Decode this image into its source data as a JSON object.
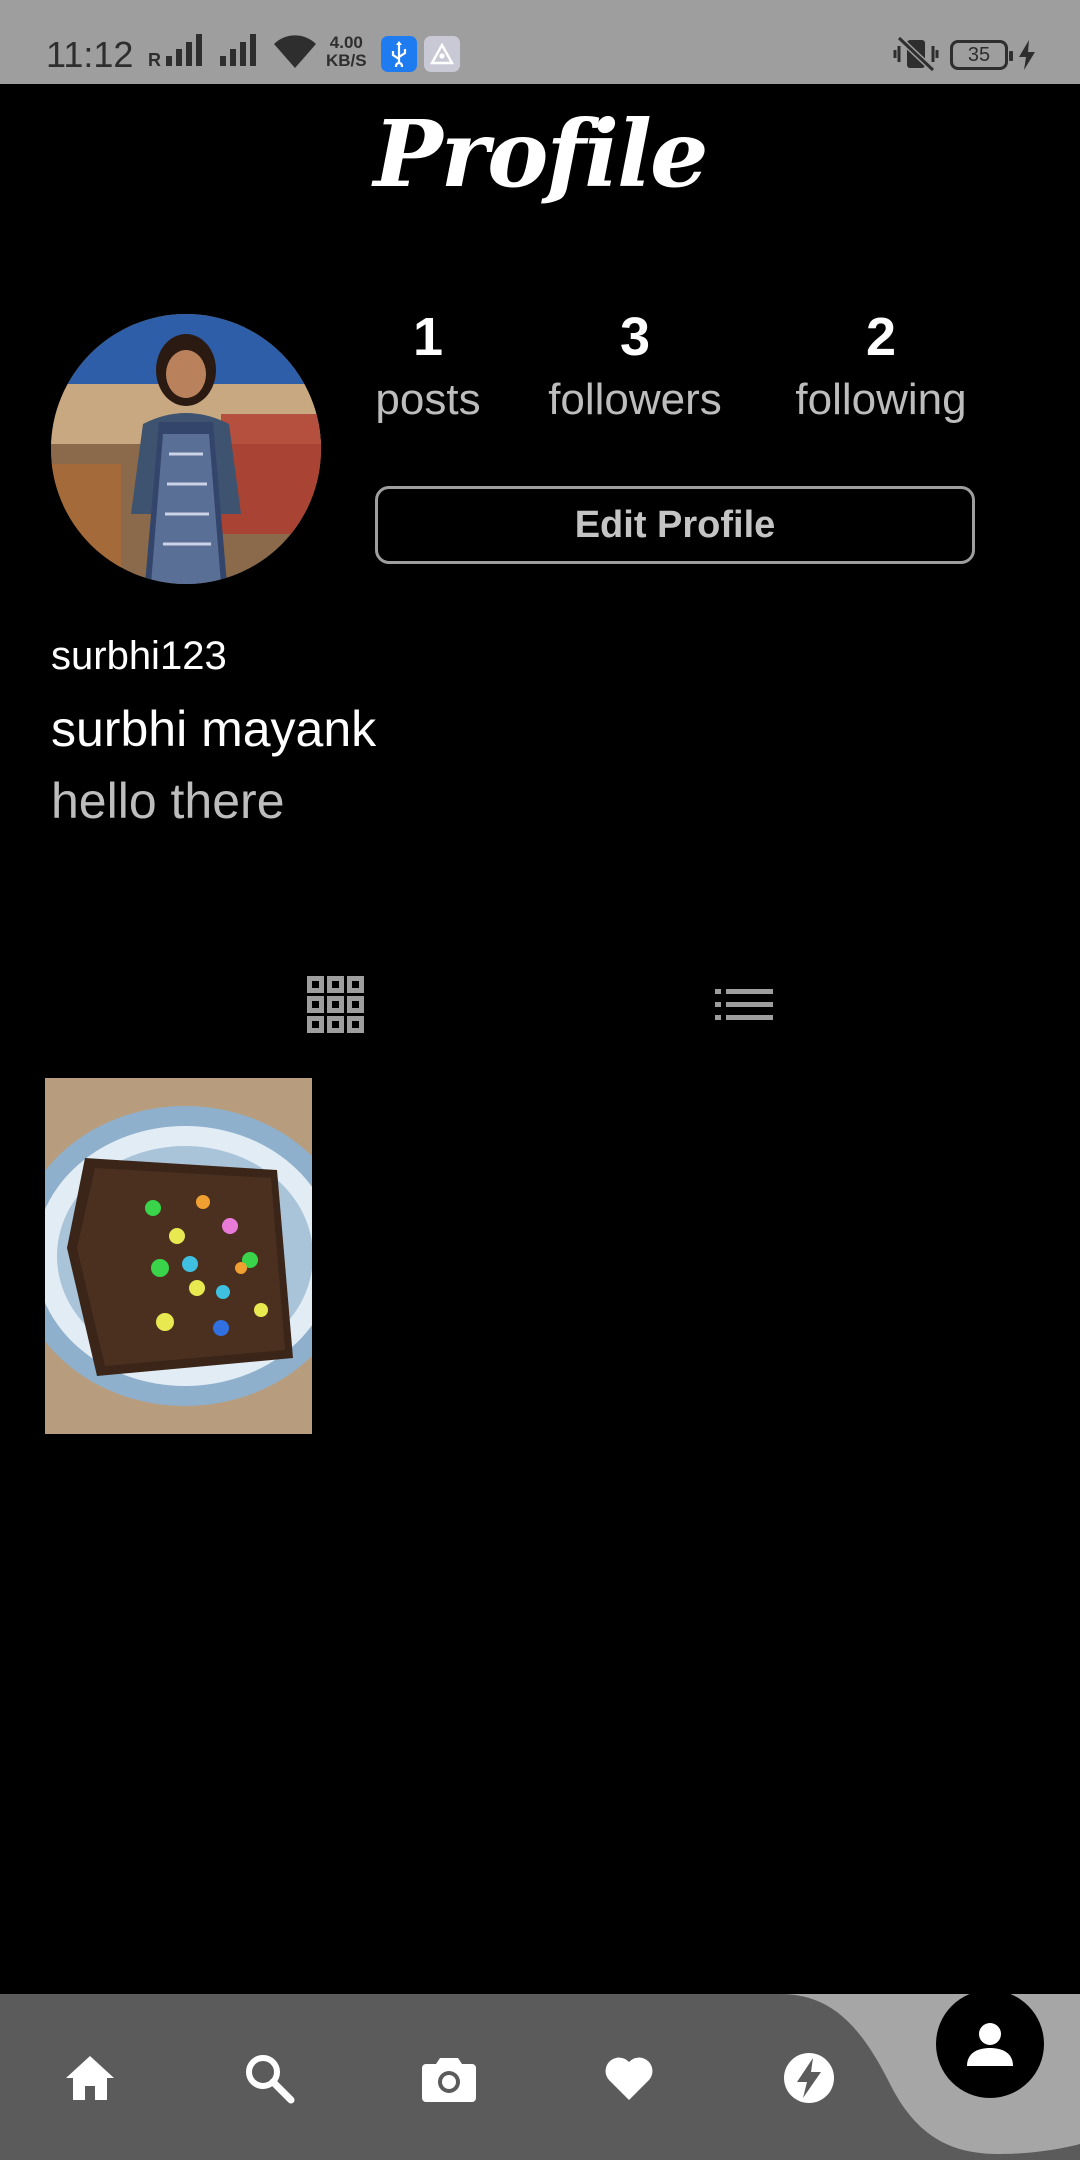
{
  "status_bar": {
    "time": "11:12",
    "network_label": "R",
    "speed_value": "4.00",
    "speed_unit": "KB/S",
    "battery": "35"
  },
  "header": {
    "title": "Profile"
  },
  "profile": {
    "stats": [
      {
        "value": "1",
        "label": "posts"
      },
      {
        "value": "3",
        "label": "followers"
      },
      {
        "value": "2",
        "label": "following"
      }
    ],
    "edit_button": "Edit Profile",
    "username": "surbhi123",
    "full_name": "surbhi mayank",
    "bio": "hello there"
  },
  "tabs": [
    {
      "icon": "grid-icon",
      "active": true
    },
    {
      "icon": "list-icon",
      "active": false
    }
  ],
  "posts_count": 1,
  "bottom_nav": {
    "items": [
      "home-icon",
      "search-icon",
      "camera-icon",
      "heart-icon",
      "flash-icon",
      "person-icon"
    ],
    "active": "person-icon"
  }
}
